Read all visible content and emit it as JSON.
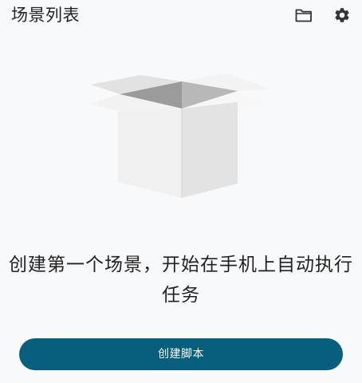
{
  "header": {
    "title": "场景列表",
    "folder_icon": "folder-icon",
    "settings_icon": "gear-icon"
  },
  "empty_state": {
    "illustration": "empty-box-illustration",
    "message": "创建第一个场景，开始在手机上自动执行任务"
  },
  "actions": {
    "create_label": "创建脚本"
  },
  "colors": {
    "accent": "#075e7d",
    "background": "#f8f9fb"
  }
}
